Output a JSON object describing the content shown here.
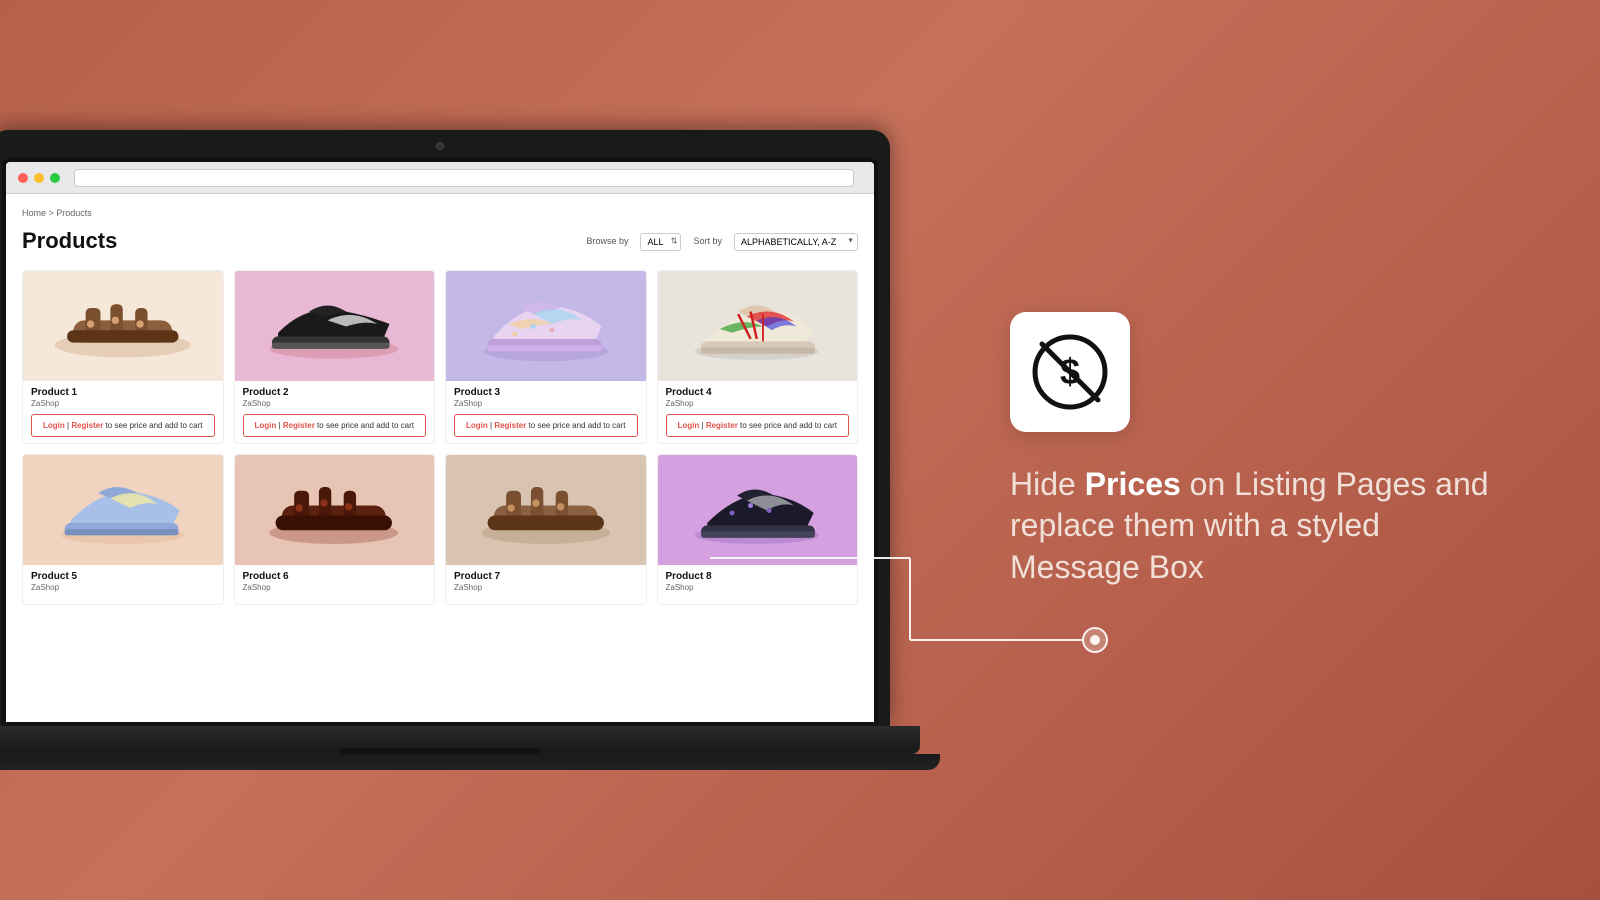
{
  "background_color": "#b5614a",
  "browser": {
    "address_bar_placeholder": ""
  },
  "page": {
    "breadcrumb": "Home > Products",
    "title": "Products",
    "filter_label": "Browse by",
    "filter_value": "ALL",
    "sort_label": "Sort by",
    "sort_value": "ALPHABETICALLY, A-Z"
  },
  "products": [
    {
      "id": 1,
      "name": "Product 1",
      "vendor": "ZaShop",
      "bg_class": "bg-cream",
      "shoe_color": "sandal-brown"
    },
    {
      "id": 2,
      "name": "Product 2",
      "vendor": "ZaShop",
      "bg_class": "bg-pink",
      "shoe_color": "sneaker-black"
    },
    {
      "id": 3,
      "name": "Product 3",
      "vendor": "ZaShop",
      "bg_class": "bg-lavender",
      "shoe_color": "sneaker-pastel"
    },
    {
      "id": 4,
      "name": "Product 4",
      "vendor": "ZaShop",
      "bg_class": "bg-gray",
      "shoe_color": "sneaker-colorful"
    },
    {
      "id": 5,
      "name": "Product 5",
      "vendor": "ZaShop",
      "bg_class": "bg-peach",
      "shoe_color": "sneaker-blue"
    },
    {
      "id": 6,
      "name": "Product 6",
      "vendor": "ZaShop",
      "bg_class": "bg-salmon",
      "shoe_color": "sandal-dark"
    },
    {
      "id": 7,
      "name": "Product 7",
      "vendor": "ZaShop",
      "bg_class": "bg-tan",
      "shoe_color": "sandal-brown2"
    },
    {
      "id": 8,
      "name": "Product 8",
      "vendor": "ZaShop",
      "bg_class": "bg-purple",
      "shoe_color": "sneaker-dark2"
    }
  ],
  "login_box": {
    "login_text": "Login",
    "separator": " | ",
    "register_text": "Register",
    "suffix": " to see price and add to cart"
  },
  "annotation": {
    "icon_label": "no-price-icon",
    "text_part1": "Hide ",
    "text_bold": "Prices",
    "text_part2": " on Listing Pages and replace them with a styled Message Box"
  }
}
